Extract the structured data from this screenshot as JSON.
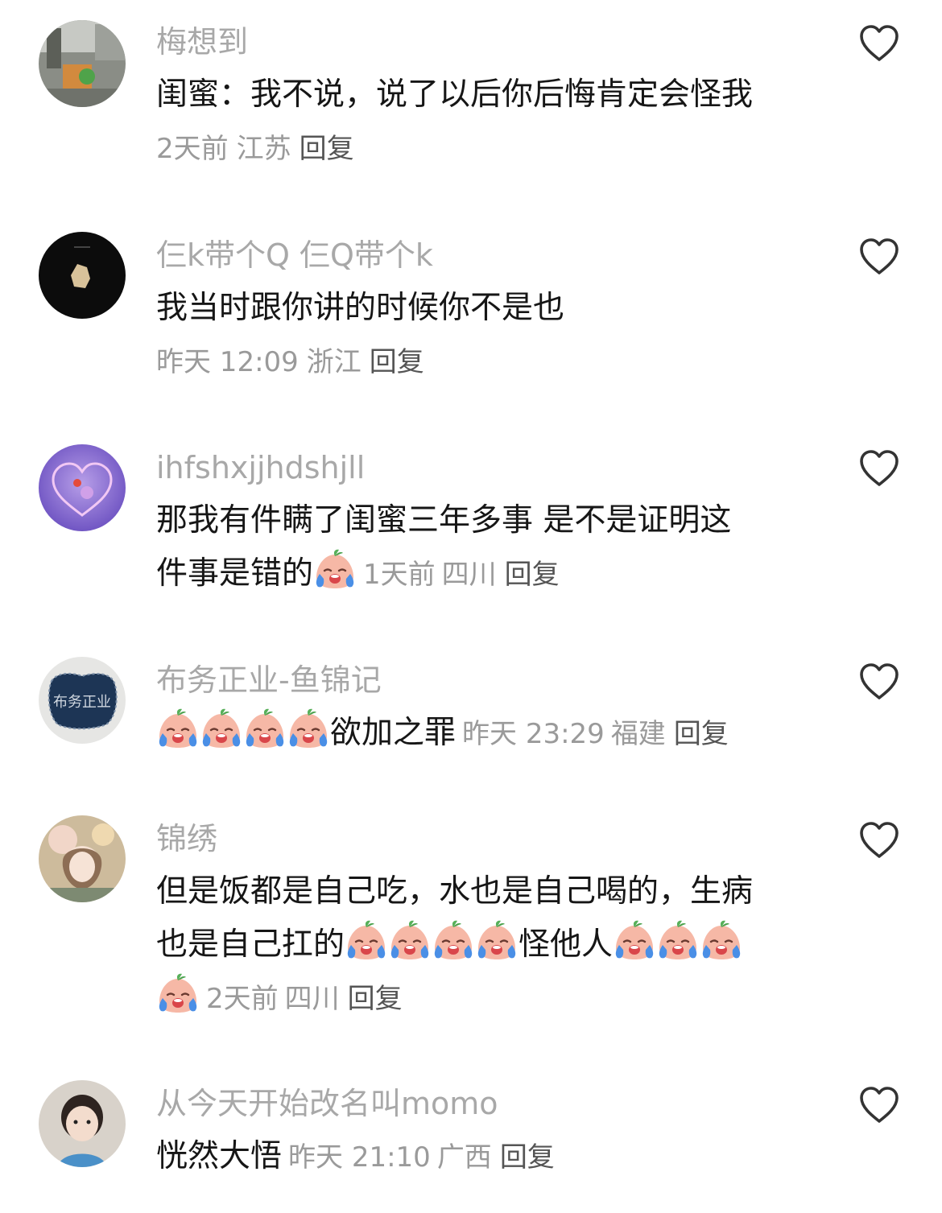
{
  "comments": [
    {
      "username": "梅想到",
      "text": "闺蜜：我不说，说了以后你后悔肯定会怪我",
      "time": "2天前",
      "location": "江苏",
      "reply": "回复",
      "avatar": "avatar-photo-street-scene"
    },
    {
      "username": "仨k带个Q 仨Q带个k",
      "text": "我当时跟你讲的时候你不是也",
      "time": "昨天 12:09",
      "location": "浙江",
      "reply": "回复",
      "avatar": "avatar-dark-object"
    },
    {
      "username": "ihfshxjjhdshjll",
      "text_line1": "那我有件瞒了闺蜜三年多事 是不是证明这",
      "text_line2": "件事是错的",
      "time": "1天前",
      "location": "四川",
      "reply": "回复",
      "avatar": "avatar-purple-heart"
    },
    {
      "username": "布务正业-鱼锦记",
      "text": "欲加之罪",
      "time": "昨天 23:29",
      "location": "福建",
      "reply": "回复",
      "avatar": "avatar-denim-patch",
      "avatar_text": "布务正业"
    },
    {
      "username": "锦绣",
      "text_line1": "但是饭都是自己吃，水也是自己喝的，生病",
      "text_line2a": "也是自己扛的",
      "text_line2b": "怪他人",
      "time": "2天前",
      "location": "四川",
      "reply": "回复",
      "avatar": "avatar-girl-flowers"
    },
    {
      "username": "从今天开始改名叫momo",
      "text": "恍然大悟",
      "time": "昨天 21:10",
      "location": "广西",
      "reply": "回复",
      "avatar": "avatar-baby-photo"
    }
  ],
  "icons": {
    "like": "heart-outline-icon",
    "emoji": "crying-peach-emoji"
  },
  "colors": {
    "username": "#a8a8a8",
    "body": "#161616",
    "meta": "#9a9a9a",
    "heart": "#333333"
  }
}
